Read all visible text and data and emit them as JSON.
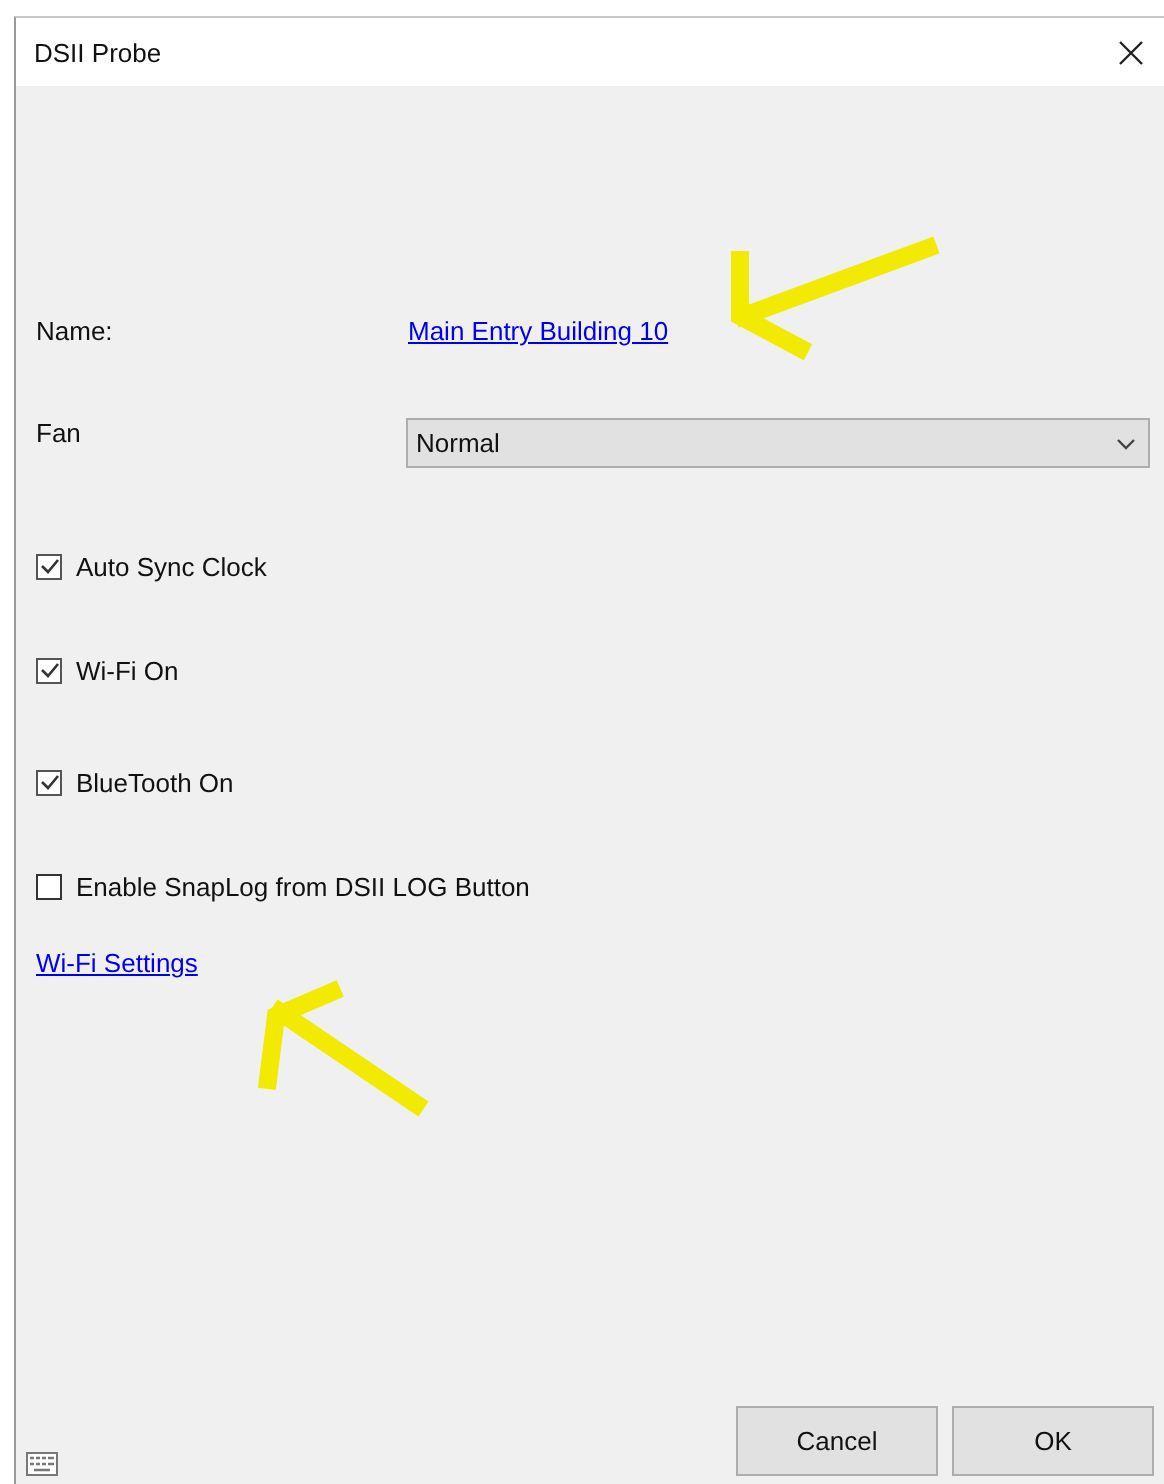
{
  "window": {
    "title": "DSII Probe"
  },
  "name_field": {
    "label": "Name:",
    "value": "Main Entry Building 10"
  },
  "fan": {
    "label": "Fan",
    "value": "Normal"
  },
  "options": [
    {
      "label": "Auto Sync Clock",
      "checked": true
    },
    {
      "label": "Wi-Fi On",
      "checked": true
    },
    {
      "label": "BlueTooth On",
      "checked": true
    },
    {
      "label": "Enable SnapLog from DSII LOG Button",
      "checked": false
    }
  ],
  "settings_link": "Wi-Fi Settings",
  "buttons": [
    "Cancel",
    "OK"
  ]
}
